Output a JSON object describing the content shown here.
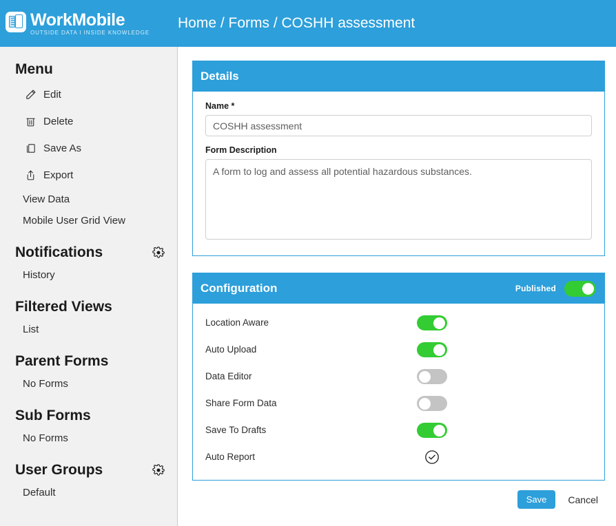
{
  "brand": {
    "name": "WorkMobile",
    "tagline": "OUTSIDE DATA I INSIDE KNOWLEDGE",
    "logo_icon": "documents-icon"
  },
  "header": {
    "breadcrumb": "Home / Forms / COSHH assessment"
  },
  "colors": {
    "accent_blue": "#2d9fda",
    "toggle_on_green": "#33cc33",
    "toggle_off_gray": "#c4c4c4",
    "sidebar_bg": "#f1f1f1"
  },
  "sidebar": {
    "sections": [
      {
        "title": "Menu",
        "has_gear": false,
        "items": [
          {
            "label": "Edit",
            "icon": "pencil-icon"
          },
          {
            "label": "Delete",
            "icon": "trash-icon"
          },
          {
            "label": "Save As",
            "icon": "copy-icon"
          },
          {
            "label": "Export",
            "icon": "upload-icon"
          },
          {
            "label": "View Data",
            "icon": ""
          },
          {
            "label": "Mobile User Grid View",
            "icon": ""
          }
        ]
      },
      {
        "title": "Notifications",
        "has_gear": true,
        "items": [
          {
            "label": "History",
            "icon": ""
          }
        ]
      },
      {
        "title": "Filtered Views",
        "has_gear": false,
        "items": [
          {
            "label": "List",
            "icon": ""
          }
        ]
      },
      {
        "title": "Parent Forms",
        "has_gear": false,
        "items": [
          {
            "label": "No Forms",
            "icon": ""
          }
        ]
      },
      {
        "title": "Sub Forms",
        "has_gear": false,
        "items": [
          {
            "label": "No Forms",
            "icon": ""
          }
        ]
      },
      {
        "title": "User Groups",
        "has_gear": true,
        "items": [
          {
            "label": "Default",
            "icon": ""
          }
        ]
      }
    ]
  },
  "details_card": {
    "title": "Details",
    "name_label": "Name *",
    "name_value": "COSHH assessment",
    "name_placeholder": "Name",
    "description_label": "Form Description",
    "description_value": "A form to log and assess all potential hazardous substances.",
    "description_placeholder": "Form Description"
  },
  "configuration_card": {
    "title": "Configuration",
    "published_label": "Published",
    "published_state": "on",
    "rows": [
      {
        "label": "Location Aware",
        "control": "toggle",
        "state": "on"
      },
      {
        "label": "Auto Upload",
        "control": "toggle",
        "state": "on"
      },
      {
        "label": "Data Editor",
        "control": "toggle",
        "state": "off"
      },
      {
        "label": "Share Form Data",
        "control": "toggle",
        "state": "off"
      },
      {
        "label": "Save To Drafts",
        "control": "toggle",
        "state": "on"
      },
      {
        "label": "Auto Report",
        "control": "check-circle-icon",
        "state": "checked"
      }
    ]
  },
  "footer": {
    "save_label": "Save",
    "cancel_label": "Cancel"
  }
}
